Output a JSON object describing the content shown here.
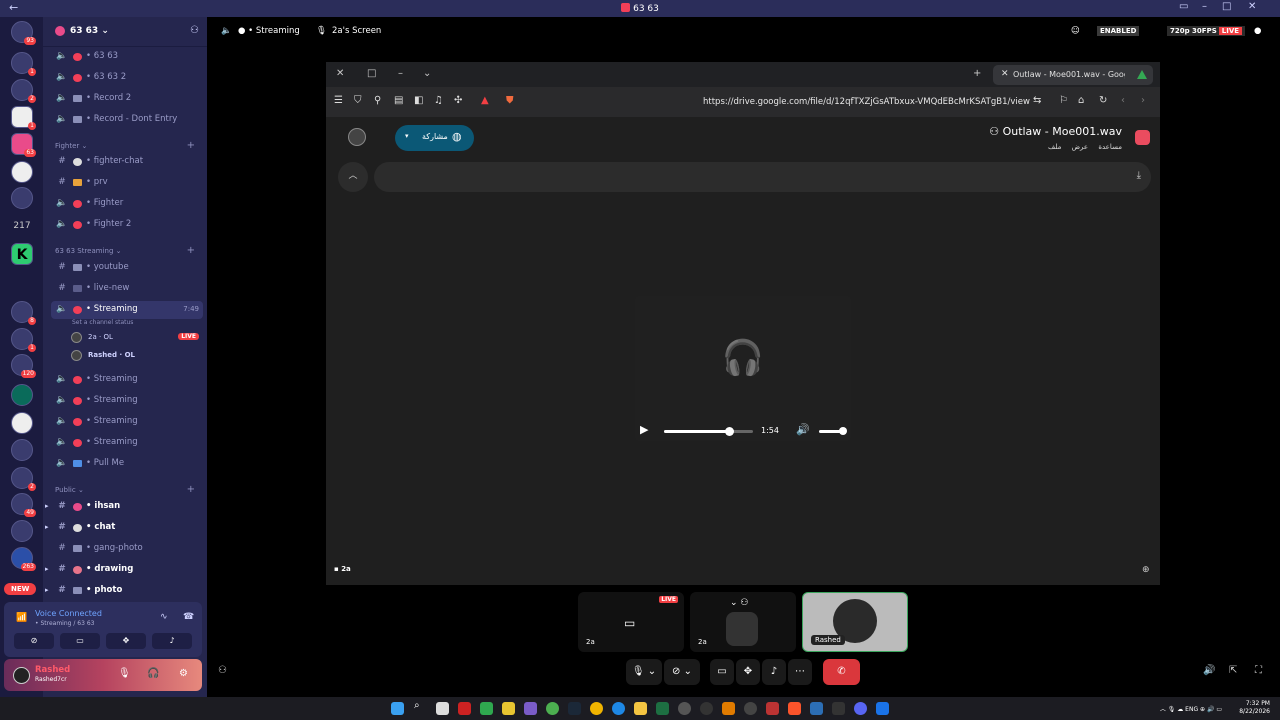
{
  "window": {
    "title": "63 63"
  },
  "server": {
    "name": "63 63"
  },
  "channels": [
    {
      "label": "63 63",
      "icon": "speaker",
      "emoji": "red"
    },
    {
      "label": "63 63 2",
      "icon": "speaker",
      "emoji": "red"
    },
    {
      "label": "Record 2",
      "icon": "speaker",
      "emoji": "list"
    },
    {
      "label": "Record - Dont Entry",
      "icon": "speaker",
      "emoji": "list"
    }
  ],
  "categories": {
    "fighter": "Fighter",
    "streaming": "63 63 Streaming",
    "public": "Public"
  },
  "fighter_channels": [
    "fighter-chat",
    "prv",
    "Fighter",
    "Fighter 2"
  ],
  "streaming_channels": [
    "youtube",
    "live-new"
  ],
  "active_channel": {
    "label": "Streaming",
    "time": "7:49",
    "status": "Set a channel status"
  },
  "voice_users": [
    {
      "name": "2a",
      "tag": "OL",
      "live": "LIVE"
    },
    {
      "name": "Rashed",
      "tag": "OL"
    }
  ],
  "more_streaming": [
    "Streaming",
    "Streaming",
    "Streaming",
    "Streaming",
    "Pull Me"
  ],
  "public_channels": [
    "ihsan",
    "chat",
    "gang-photo",
    "drawing",
    "photo"
  ],
  "new_badge": "NEW",
  "server_badges": [
    "93",
    "1",
    "2",
    "1",
    "63",
    "8",
    "1",
    "120",
    "2",
    "49",
    "263"
  ],
  "voice": {
    "status": "Voice Connected",
    "channel": "Streaming / 63 63"
  },
  "user": {
    "name": "Rashed",
    "status": "Rashed7cr"
  },
  "header": {
    "channel": "Streaming",
    "screen": "2a's Screen",
    "enabled": "ENABLED",
    "quality": "720p 30FPS",
    "live": "LIVE"
  },
  "browser": {
    "tab_title": "Outlaw - Moe001.wav - Goog",
    "url": "https://drive.google.com/file/d/12qfTXZjGsATbxux-VMQdEBcMrKSATgB1/view",
    "share": "مشاركة",
    "file_name": "Outlaw - Moe001.wav",
    "menu": [
      "ملف",
      "عرض",
      "مساعدة"
    ]
  },
  "audio": {
    "time": "1:54",
    "progress": 0.73,
    "volume": 0.85
  },
  "stream_tag": "2a",
  "tiles": [
    {
      "label": "2a",
      "live": "LIVE"
    },
    {
      "label": "2a"
    },
    {
      "label": "Rashed"
    }
  ],
  "taskbar": {
    "lang": "ENG",
    "time": "7:32 PM",
    "date": "8/22/2026"
  }
}
